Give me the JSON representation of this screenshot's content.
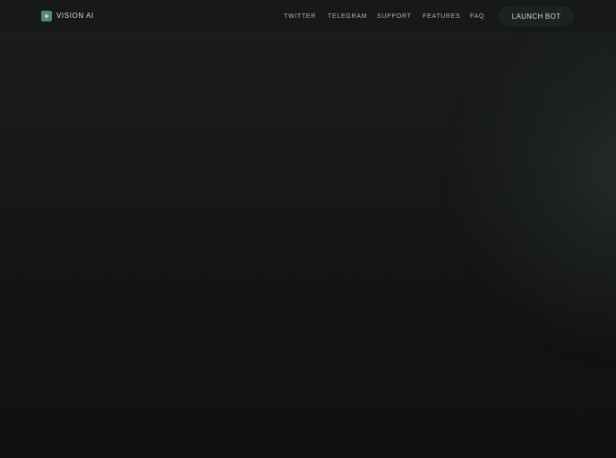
{
  "brand": {
    "name": "VISION AI",
    "logo_icon": "sparkle-icon",
    "logo_color": "#4f8a72"
  },
  "nav": {
    "items": [
      {
        "label": "TWITTER"
      },
      {
        "label": "TELEGRAM"
      },
      {
        "label": "SUPPORT"
      },
      {
        "label": "FEATURES"
      },
      {
        "label": "FAQ"
      }
    ]
  },
  "cta": {
    "label": "LAUNCH BOT"
  },
  "theme": {
    "background": "#111313",
    "text": "#aab2ae"
  }
}
